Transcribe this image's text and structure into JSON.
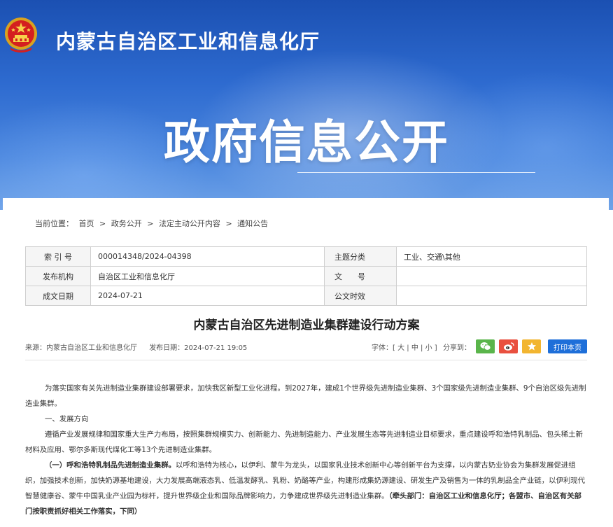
{
  "header": {
    "site_title": "内蒙古自治区工业和信息化厅",
    "section_title": "政府信息公开"
  },
  "breadcrumb": {
    "prefix": "当前位置：",
    "items": [
      "首页",
      "政务公开",
      "法定主动公开内容",
      "通知公告"
    ],
    "separator": ">"
  },
  "meta": {
    "index_label": "索 引 号",
    "index_value": "000014348/2024-04398",
    "subject_label": "主题分类",
    "subject_value": "工业、交通\\其他",
    "publisher_label": "发布机构",
    "publisher_value": "自治区工业和信息化厅",
    "docno_label": "文　　号",
    "docno_value": "",
    "date_label": "成文日期",
    "date_value": "2024-07-21",
    "validity_label": "公文时效",
    "validity_value": ""
  },
  "article": {
    "title": "内蒙古自治区先进制造业集群建设行动方案",
    "source": "来源：内蒙古自治区工业和信息化厅",
    "publish_time": "发布日期：2024-07-21 19:05",
    "font_label": "字体：",
    "font_open": "[",
    "font_large": "大",
    "font_mid": "中",
    "font_small": "小",
    "font_close": "]",
    "share_label": "分享到：",
    "print_label": "打印本页",
    "p1": "为落实国家有关先进制造业集群建设部署要求，加快我区新型工业化进程。到2027年，建成1个世界级先进制造业集群、3个国家级先进制造业集群、9个自治区级先进制造业集群。",
    "h1": "一、发展方向",
    "p2": "遵循产业发展规律和国家重大生产力布局，按照集群规模实力、创新能力、先进制造能力、产业发展生态等先进制造业目标要求，重点建设呼和浩特乳制品、包头稀土新材料及应用、鄂尔多斯现代煤化工等13个先进制造业集群。",
    "p3_bold": "（一）呼和浩特乳制品先进制造业集群。",
    "p3_text": "以呼和浩特为核心，以伊利、蒙牛为龙头，以国家乳业技术创新中心等创新平台为支撑，以内蒙古奶业协会为集群发展促进组织，加强技术创新，加快奶源基地建设，大力发展高端液态乳、低温发酵乳、乳粉、奶酪等产业，构建形成集奶源建设、研发生产及销售为一体的乳制品全产业链，以伊利现代智慧健康谷、蒙牛中国乳业产业园为标杆，提升世界级企业和国际品牌影响力，力争建成世界级先进制造业集群。",
    "p3_tail": "（牵头部门：自治区工业和信息化厅；各盟市、自治区有关部门按职责抓好相关工作落实，下同）"
  },
  "colors": {
    "banner_top": "#1b50b2",
    "banner_bottom": "#6fa3e8",
    "print_button": "#1e6fd9",
    "wechat": "#5ab54b",
    "weibo": "#e9503f",
    "qzone": "#f2b530"
  },
  "icons": [
    "national-emblem-icon",
    "wechat-icon",
    "weibo-icon",
    "qzone-star-icon"
  ]
}
